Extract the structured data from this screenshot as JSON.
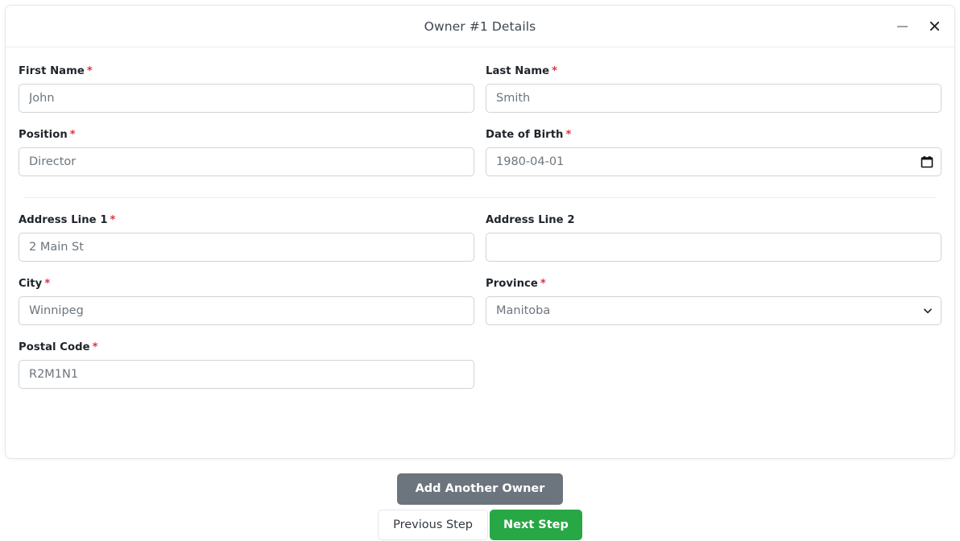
{
  "modal": {
    "title": "Owner #1 Details",
    "controls": {
      "minimize_name": "minimize-icon",
      "close_name": "close-icon"
    }
  },
  "form": {
    "rows": [
      {
        "left": {
          "label": "First Name",
          "required": true,
          "value": "John",
          "type": "text",
          "name": "first-name"
        },
        "right": {
          "label": "Last Name",
          "required": true,
          "value": "Smith",
          "type": "text",
          "name": "last-name"
        }
      },
      {
        "left": {
          "label": "Position",
          "required": true,
          "value": "Director",
          "type": "text",
          "name": "position"
        },
        "right": {
          "label": "Date of Birth",
          "required": true,
          "value": "1980-04-01",
          "type": "date",
          "name": "date-of-birth",
          "icon": "calendar-icon"
        }
      },
      {
        "left": {
          "label": "Address Line 1",
          "required": true,
          "value": "2 Main St",
          "type": "text",
          "name": "address-line-1"
        },
        "right": {
          "label": "Address Line 2",
          "required": false,
          "value": "",
          "type": "text",
          "name": "address-line-2"
        }
      },
      {
        "left": {
          "label": "City",
          "required": true,
          "value": "Winnipeg",
          "type": "text",
          "name": "city"
        },
        "right": {
          "label": "Province",
          "required": true,
          "value": "Manitoba",
          "type": "select",
          "name": "province",
          "icon": "chevron-down-icon"
        }
      },
      {
        "left": {
          "label": "Postal Code",
          "required": true,
          "value": "R2M1N1",
          "type": "text",
          "name": "postal-code"
        },
        "right": null
      }
    ],
    "required_marker": "*"
  },
  "footer": {
    "add_owner_label": "Add Another Owner",
    "previous_label": "Previous Step",
    "next_label": "Next Step"
  },
  "colors": {
    "secondary": "#6c757d",
    "success": "#28a745",
    "required": "#dc3545",
    "border": "#ced4da",
    "text": "#6c757d",
    "label": "#1f242a"
  }
}
